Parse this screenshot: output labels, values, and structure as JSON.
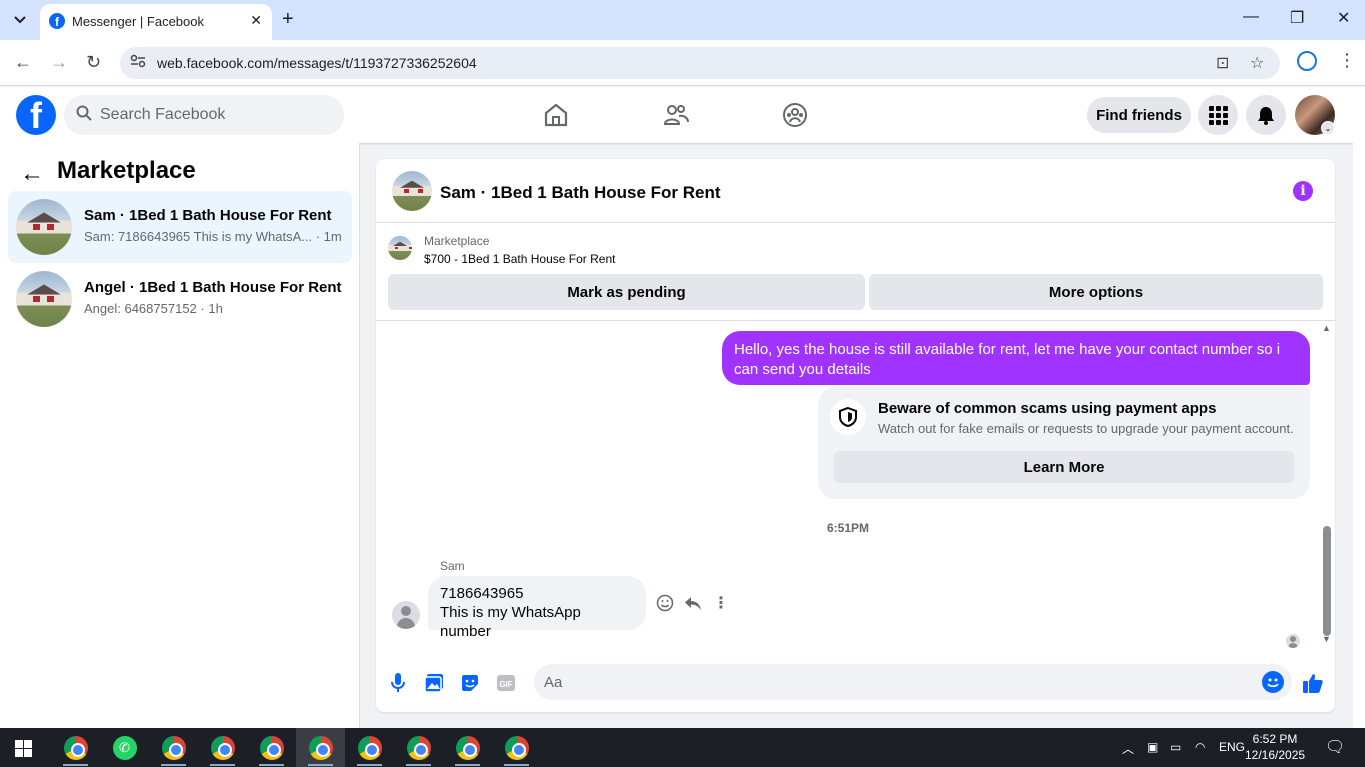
{
  "browser": {
    "tab_title": "Messenger | Facebook",
    "url": "web.facebook.com/messages/t/1193727336252604"
  },
  "fb": {
    "search_placeholder": "Search Facebook",
    "find_friends": "Find friends"
  },
  "sidebar": {
    "title": "Marketplace",
    "conversations": [
      {
        "name": "Sam · 1Bed 1 Bath House For Rent",
        "preview": "Sam: 7186643965 This is my WhatsA...",
        "time": "· 1m",
        "active": true
      },
      {
        "name": "Angel · 1Bed 1 Bath House For Rent",
        "preview": "Angel: 6468757152",
        "time": "· 1h",
        "active": false
      }
    ]
  },
  "chat": {
    "title": "Sam · 1Bed 1 Bath House For Rent",
    "marketplace_label": "Marketplace",
    "listing": "$700 - 1Bed 1 Bath House For Rent",
    "mark_pending": "Mark as pending",
    "more_options": "More options",
    "outgoing_message": "Hello, yes the house is still available for rent, let me have your contact number so i can send you  details",
    "scam_title": "Beware of common scams using payment apps",
    "scam_sub": "Watch out for fake emails or requests to upgrade your payment account.",
    "learn_more": "Learn More",
    "timestamp": "6:51PM",
    "sender_name": "Sam",
    "incoming_line1": "7186643965",
    "incoming_line2": "This is my WhatsApp number",
    "composer_placeholder": "Aa"
  },
  "taskbar": {
    "language": "ENG",
    "time": "6:52 PM",
    "date": "12/16/2025"
  },
  "colors": {
    "accent_purple": "#a033ff",
    "fb_blue": "#0866ff"
  }
}
